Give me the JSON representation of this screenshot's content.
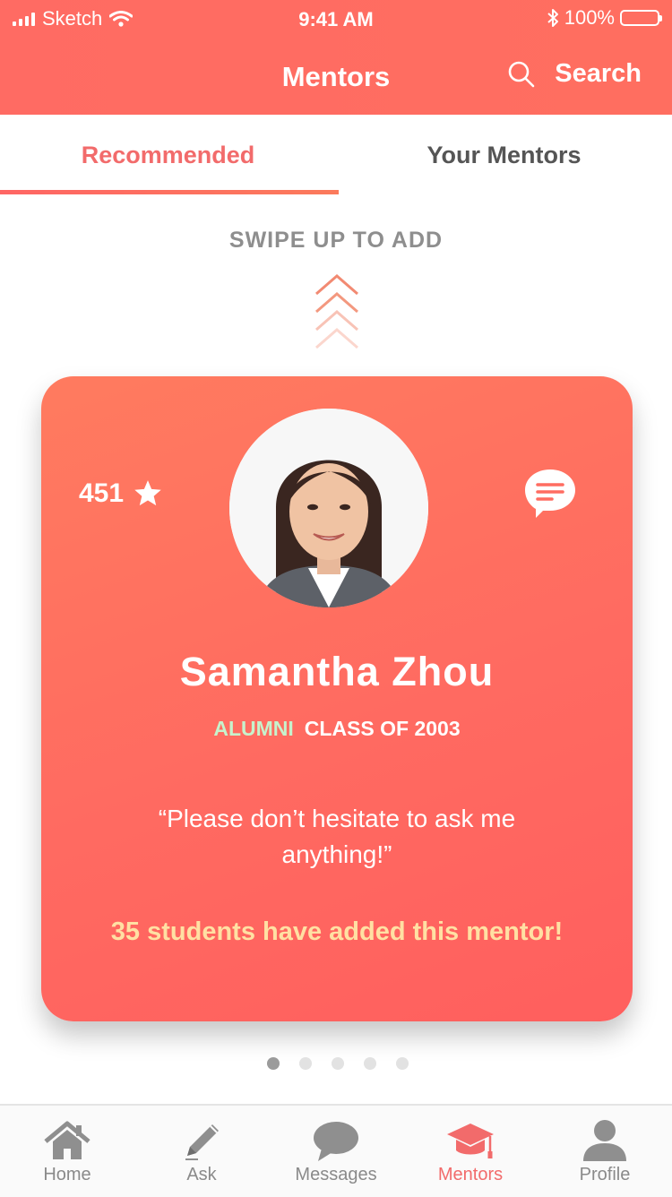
{
  "status_bar": {
    "carrier": "Sketch",
    "time": "9:41 AM",
    "battery": "100%"
  },
  "header": {
    "title": "Mentors",
    "search_label": "Search"
  },
  "tabs": [
    {
      "label": "Recommended",
      "active": true
    },
    {
      "label": "Your Mentors",
      "active": false
    }
  ],
  "swipe_hint": "SWIPE UP TO ADD",
  "mentor": {
    "rating": "451",
    "name": "Samantha Zhou",
    "badge": "ALUMNI",
    "class_year": "CLASS OF 2003",
    "quote": "“Please don’t hesitate to ask me anything!”",
    "added_count_text": "35 students have added this mentor!"
  },
  "pagination": {
    "total": 5,
    "active": 1
  },
  "tab_bar": [
    {
      "label": "Home",
      "icon": "home-icon"
    },
    {
      "label": "Ask",
      "icon": "pencil-icon"
    },
    {
      "label": "Messages",
      "icon": "speech-bubble-icon"
    },
    {
      "label": "Mentors",
      "icon": "graduation-cap-icon",
      "active": true
    },
    {
      "label": "Profile",
      "icon": "person-icon"
    }
  ],
  "colors": {
    "accent": "#ff6b63",
    "alumni": "#c7f2cc",
    "added_text": "#ffe0a3",
    "inactive_tab": "#8a8a8a"
  }
}
